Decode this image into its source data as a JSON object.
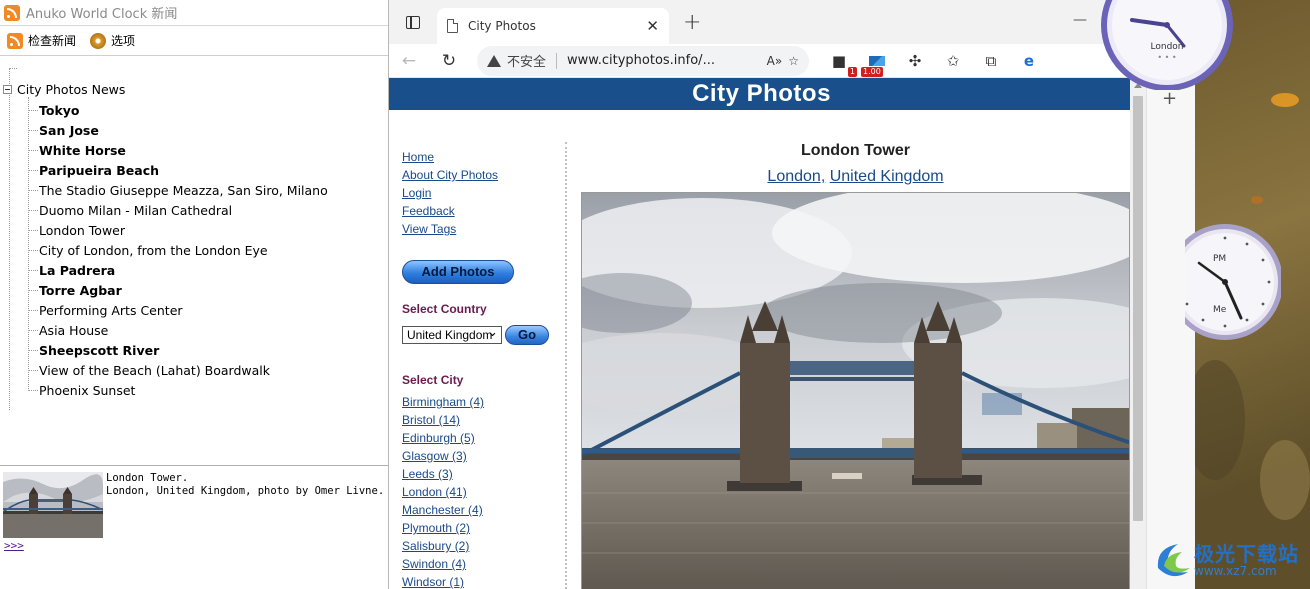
{
  "left_app": {
    "title": "Anuko World Clock 新闻",
    "toolbar": {
      "check_news": "检查新闻",
      "options": "选项"
    },
    "tree": {
      "root": "City Photos News",
      "items": [
        {
          "label": "Tokyo",
          "unread": true
        },
        {
          "label": "San Jose",
          "unread": true
        },
        {
          "label": "White Horse",
          "unread": true
        },
        {
          "label": "Paripueira Beach",
          "unread": true
        },
        {
          "label": "The Stadio Giuseppe Meazza, San Siro, Milano",
          "unread": false
        },
        {
          "label": "Duomo Milan - Milan Cathedral",
          "unread": false
        },
        {
          "label": "London Tower",
          "unread": false
        },
        {
          "label": "City of London, from the London Eye",
          "unread": false
        },
        {
          "label": "La Padrera",
          "unread": true
        },
        {
          "label": "Torre Agbar",
          "unread": true
        },
        {
          "label": "Performing Arts Center",
          "unread": false
        },
        {
          "label": "Asia House",
          "unread": false
        },
        {
          "label": "Sheepscott River",
          "unread": true
        },
        {
          "label": "View of the Beach (Lahat) Boardwalk",
          "unread": false
        },
        {
          "label": "Phoenix Sunset",
          "unread": false
        }
      ]
    },
    "preview": {
      "line1": "London Tower.",
      "line2": "London, United Kingdom, photo by Omer Livne.",
      "more": ">>> "
    }
  },
  "browser": {
    "tab_title": "City Photos",
    "close_glyph": "✕",
    "new_tab_glyph": "+",
    "insecure_label": "不安全",
    "url": "www.cityphotos.info/...",
    "ext_badge_1": "1",
    "ext_badge_2": "1.00"
  },
  "site": {
    "header": "City Photos",
    "nav": [
      "Home",
      "About City Photos",
      "Login",
      "Feedback",
      "View Tags"
    ],
    "add_photos": "Add Photos",
    "select_country": "Select Country",
    "country_selected": "United Kingdom",
    "go": "Go",
    "select_city": "Select City",
    "cities": [
      "Birmingham (4)",
      "Bristol (14)",
      "Edinburgh (5)",
      "Glasgow (3)",
      "Leeds (3)",
      "London (41)",
      "Manchester (4)",
      "Plymouth (2)",
      "Salisbury (2)",
      "Swindon (4)",
      "Windsor (1)"
    ],
    "photo_title": "London Tower",
    "photo_city": "London,",
    "photo_country": "United Kingdom"
  },
  "desktop": {
    "clock_london_label": "London",
    "clock2_pm": "PM",
    "clock2_label": "Me",
    "watermark_main": "极光下载站",
    "watermark_sub": "www.xz7.com"
  },
  "colors": {
    "site_header": "#194f8a",
    "link": "#1a4a8a",
    "heading_purple": "#6a1b4d"
  }
}
